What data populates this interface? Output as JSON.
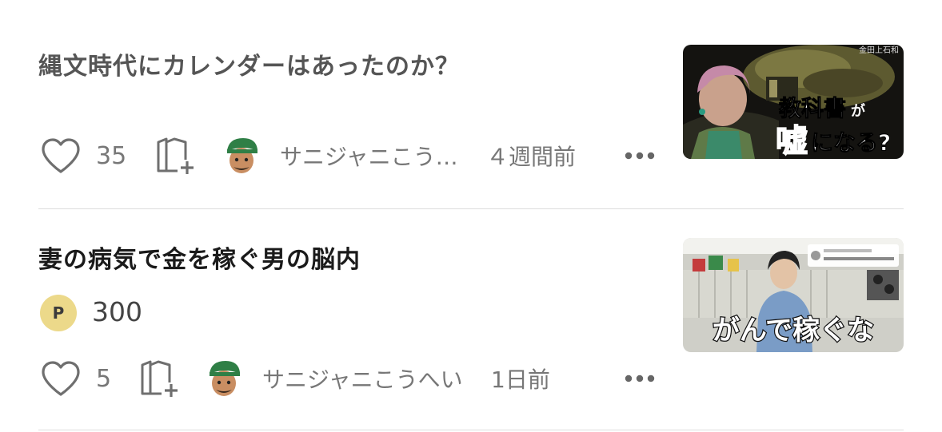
{
  "articles": [
    {
      "title": "縄文時代にカレンダーはあったのか？",
      "likes": "35",
      "author": "サニジャニこう…",
      "time": "４週間前",
      "thumbnail_text": {
        "top_label": "金田上石和",
        "line1": "教科書",
        "line1_small": "が",
        "line2_red": "嘘",
        "line2": "になる?"
      }
    },
    {
      "title": "妻の病気で金を稼ぐ男の脳内",
      "price_badge": "P",
      "price": "300",
      "likes": "5",
      "author": "サニジャニこうへい",
      "time": "1日前",
      "thumbnail_text": {
        "caption": "がんで稼ぐな"
      }
    }
  ],
  "icons": {
    "like": "heart-icon",
    "save": "bookmark-add-icon",
    "avatar": "author-avatar",
    "more": "more-dots-icon"
  },
  "colors": {
    "divider": "#dddddd",
    "price_badge": "#ecd98a",
    "thumb_red": "#d6141c"
  }
}
